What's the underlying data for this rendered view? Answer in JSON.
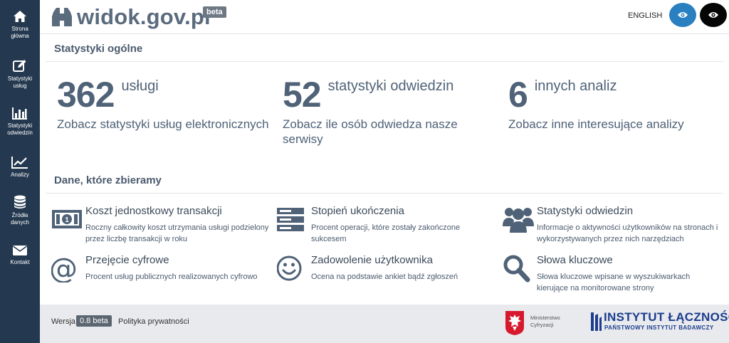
{
  "sidebar": {
    "items": [
      {
        "label": "Strona\ngłówna",
        "icon": "home-icon"
      },
      {
        "label": "Statystyki\nusług",
        "icon": "edit-icon"
      },
      {
        "label": "Statystyki\nodwiedzin",
        "icon": "bar-chart-icon"
      },
      {
        "label": "Analizy",
        "icon": "line-chart-icon"
      },
      {
        "label": "Źródła\ndanych",
        "icon": "database-icon"
      },
      {
        "label": "Kontakt",
        "icon": "envelope-icon"
      }
    ]
  },
  "header": {
    "logo_text": "widok.gov.pl",
    "beta_badge": "beta",
    "language_link": "ENGLISH",
    "accessibility_buttons": [
      "eye-icon",
      "eye-icon"
    ]
  },
  "general_stats": {
    "title": "Statystyki ogólne",
    "items": [
      {
        "number": "362",
        "unit": "usługi",
        "link": "Zobacz statystyki usług elektronicznych"
      },
      {
        "number": "52",
        "unit": "statystyki odwiedzin",
        "link": "Zobacz ile osób odwiedza nasze serwisy"
      },
      {
        "number": "6",
        "unit": "innych analiz",
        "link": "Zobacz inne interesujące analizy"
      }
    ]
  },
  "data_collected": {
    "title": "Dane, które zbieramy",
    "items": [
      {
        "title": "Koszt jednostkowy transakcji",
        "desc": "Roczny całkowity koszt utrzymania usługi podzielony przez liczbę transakcji w roku",
        "icon": "banknote-icon"
      },
      {
        "title": "Stopień ukończenia",
        "desc": "Procent operacji, które zostały zakończone sukcesem",
        "icon": "server-icon"
      },
      {
        "title": "Statystyki odwiedzin",
        "desc": "Informacje o aktywności użytkowników na stronach i wykorzystywanych przez nich narzędziach",
        "icon": "users-icon"
      },
      {
        "title": "Przejęcie cyfrowe",
        "desc": "Procent usług publicznych realizowanych cyfrowo",
        "icon": "at-icon"
      },
      {
        "title": "Zadowolenie użytkownika",
        "desc": "Ocena na podstawie ankiet bądź zgłoszeń",
        "icon": "smile-icon"
      },
      {
        "title": "Słowa kluczowe",
        "desc": "Słowa kluczowe wpisane w wyszukiwarkach kierujące na monitorowane strony",
        "icon": "search-icon"
      }
    ]
  },
  "footer": {
    "version_label": "Wersja",
    "version_value": "0.8 beta",
    "privacy_link": "Polityka prywatności",
    "ministry_text": "Ministerstwo\nCyfryzacji",
    "institute_name": "INSTYTUT ŁĄCZNOŚCI",
    "institute_subtitle": "PAŃSTWOWY INSTYTUT BADAWCZY"
  },
  "colors": {
    "sidebar_bg": "#24384f",
    "text": "#4f6277",
    "accent_blue": "#2a7fc1",
    "institute_blue": "#1c3d8f",
    "footer_bg": "#e8eaed"
  }
}
